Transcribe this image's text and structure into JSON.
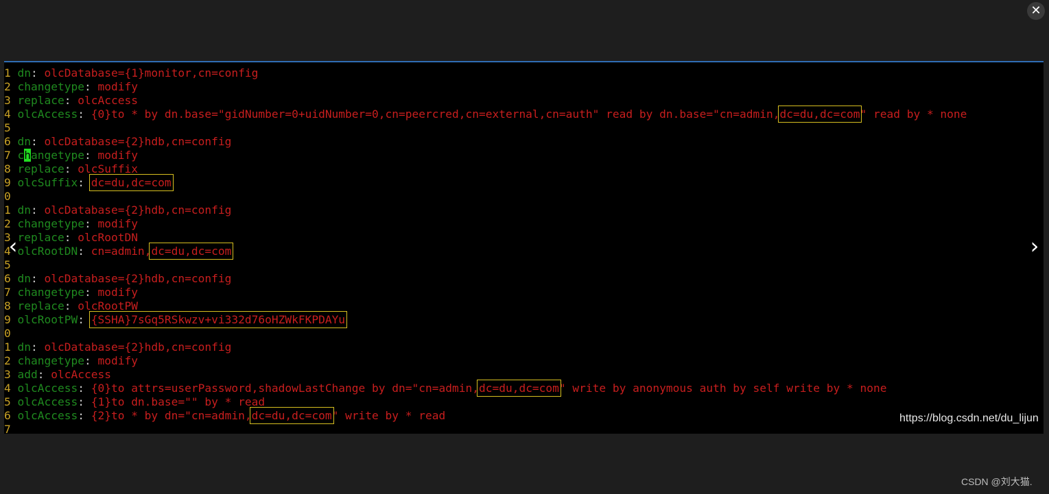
{
  "viewer": {
    "close_glyph": "✕",
    "prev_glyph": "‹",
    "next_glyph": "›",
    "watermark_url": "https://blog.csdn.net/du_lijun",
    "footer_credit": "CSDN @刘大猫."
  },
  "colors": {
    "line_number": "#c9a227",
    "keyword": "#1f8a1f",
    "value": "#c81e1e",
    "highlight_box": "#d8c020",
    "cursor": "#22dd22",
    "panel_border": "#2f6db5"
  },
  "code_lines": [
    {
      "num": "1",
      "key": "dn",
      "sep": ":",
      "val": " olcDatabase={1}monitor,cn=config"
    },
    {
      "num": "2",
      "key": "changetype",
      "sep": ":",
      "val": " modify"
    },
    {
      "num": "3",
      "key": "replace",
      "sep": ":",
      "val": " olcAccess"
    },
    {
      "num": "4",
      "key": "olcAccess",
      "sep": ":",
      "val": " {0}to * by dn.base=\"gidNumber=0+uidNumber=0,cn=peercred,cn=external,cn=auth\" read by dn.base=\"cn=admin,",
      "boxed": "dc=du,dc=com",
      "rest": "\" read by * none"
    },
    {
      "num": "5"
    },
    {
      "num": "6",
      "key": "dn",
      "sep": ":",
      "val": " olcDatabase={2}hdb,cn=config"
    },
    {
      "num": "7",
      "key_a": "c",
      "key_cursor": "h",
      "key_b": "angetype",
      "sep": ":",
      "val": " modify"
    },
    {
      "num": "8",
      "key": "replace",
      "sep": ":",
      "val": " olcSuffix"
    },
    {
      "num": "9",
      "key": "olcSuffix",
      "sep": ":",
      "val": " ",
      "boxed": "dc=du,dc=com",
      "rest": ""
    },
    {
      "num": "0"
    },
    {
      "num": "1",
      "key": "dn",
      "sep": ":",
      "val": " olcDatabase={2}hdb,cn=config"
    },
    {
      "num": "2",
      "key": "changetype",
      "sep": ":",
      "val": " modify"
    },
    {
      "num": "3",
      "key": "replace",
      "sep": ":",
      "val": " olcRootDN"
    },
    {
      "num": "4",
      "key": "olcRootDN",
      "sep": ":",
      "val": " cn=admin,",
      "boxed": "dc=du,dc=com",
      "rest": ""
    },
    {
      "num": "5"
    },
    {
      "num": "6",
      "key": "dn",
      "sep": ":",
      "val": " olcDatabase={2}hdb,cn=config"
    },
    {
      "num": "7",
      "key": "changetype",
      "sep": ":",
      "val": " modify"
    },
    {
      "num": "8",
      "key": "replace",
      "sep": ":",
      "val": " olcRootPW"
    },
    {
      "num": "9",
      "key": "olcRootPW",
      "sep": ":",
      "val": " ",
      "boxed": "{SSHA}7sGq5RSkwzv+vi332d76oHZWkFKPDAYu",
      "rest": ""
    },
    {
      "num": "0"
    },
    {
      "num": "1",
      "key": "dn",
      "sep": ":",
      "val": " olcDatabase={2}hdb,cn=config"
    },
    {
      "num": "2",
      "key": "changetype",
      "sep": ":",
      "val": " modify"
    },
    {
      "num": "3",
      "key": "add",
      "sep": ":",
      "val": " olcAccess"
    },
    {
      "num": "4",
      "key": "olcAccess",
      "sep": ":",
      "val": " {0}to attrs=userPassword,shadowLastChange by dn=\"cn=admin,",
      "boxed": "dc=du,dc=com",
      "rest": "\" write by anonymous auth by self write by * none"
    },
    {
      "num": "5",
      "key": "olcAccess",
      "sep": ":",
      "val": " {1}to dn.base=\"\" by * read"
    },
    {
      "num": "6",
      "key": "olcAccess",
      "sep": ":",
      "val": " {2}to * by dn=\"cn=admin,",
      "boxed": "dc=du,dc=com",
      "rest": "\" write by * read"
    },
    {
      "num": "7"
    }
  ]
}
